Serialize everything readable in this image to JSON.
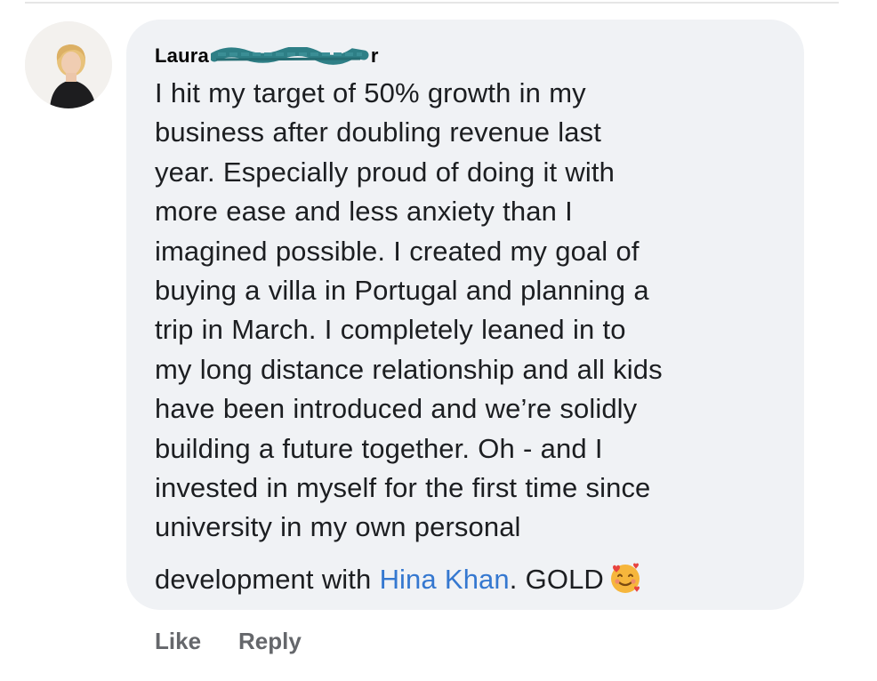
{
  "comment": {
    "author_first": "Laura",
    "author_tail": "r",
    "avatar_icon": "profile-photo",
    "lines": [
      "I hit my target of 50% growth in my",
      "business after doubling revenue last",
      "year. Especially proud of doing it with",
      "more ease and less anxiety than I",
      "imagined possible. I created my goal of",
      "buying a villa in Portugal and planning a",
      "trip in March. I completely leaned in to",
      "my long distance relationship and all kids",
      "have been introduced and we’re solidly",
      "building a future together. Oh - and I",
      "invested in myself for the first time since",
      "university in my own personal"
    ],
    "last_line_prefix": "development with ",
    "mention": "Hina Khan",
    "last_line_suffix": ". GOLD",
    "emoji_icon": "smiling-face-with-hearts-icon"
  },
  "actions": {
    "like_label": "Like",
    "reply_label": "Reply"
  },
  "colors": {
    "bubble": "#f0f2f5",
    "mention": "#3578d0",
    "action_text": "#65676b",
    "redaction": "#2e7f86"
  }
}
